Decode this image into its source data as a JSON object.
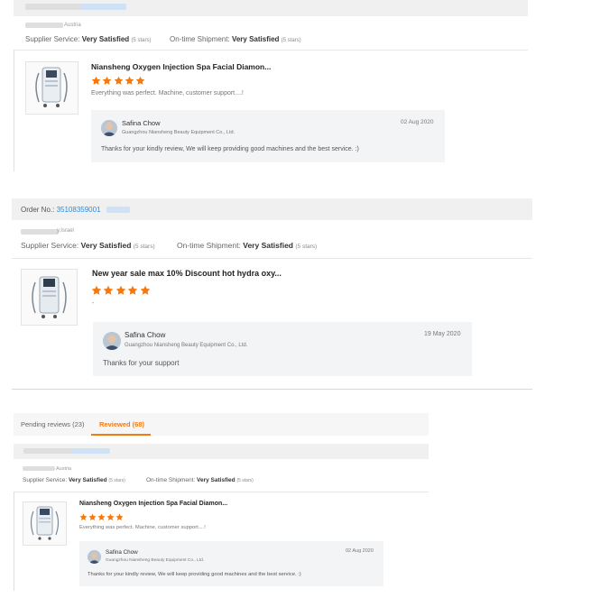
{
  "card1": {
    "country": "Austria",
    "supplier_service_label": "Supplier Service:",
    "supplier_service_value": "Very Satisfied",
    "supplier_service_stars": "(5 stars)",
    "ontime_label": "On-time Shipment:",
    "ontime_value": "Very Satisfied",
    "ontime_stars": "(5 stars)",
    "product_title": "Niansheng Oxygen Injection Spa Facial Diamon...",
    "rating": 5,
    "review": "Everything was perfect. Machine, customer support....!",
    "reply_name": "Safina Chow",
    "reply_company": "Guangzhou Niansheng Beauty Equipment Co., Ltd.",
    "reply_date": "02 Aug 2020",
    "reply_text": "Thanks for your kindly review, We will keep providing good machines and the best service. :)"
  },
  "card2": {
    "order_label": "Order No.:",
    "order_no": "35108359001",
    "country": "y,Israel",
    "supplier_service_label": "Supplier Service:",
    "supplier_service_value": "Very Satisfied",
    "supplier_service_stars": "(5 stars)",
    "ontime_label": "On-time Shipment:",
    "ontime_value": "Very Satisfied",
    "ontime_stars": "(5 stars)",
    "product_title": "New year sale max 10% Discount hot hydra oxy...",
    "rating": 5,
    "review": "-",
    "reply_name": "Safina Chow",
    "reply_company": "Guangzhou Niansheng Beauty Equipment Co., Ltd.",
    "reply_date": "19 May 2020",
    "reply_text": "Thanks for your support"
  },
  "tabs": {
    "pending": "Pending reviews (23)",
    "reviewed": "Reviewed (68)"
  },
  "card3": {
    "country": "Austria",
    "supplier_service_label": "Supplier Service:",
    "supplier_service_value": "Very Satisfied",
    "supplier_service_stars": "(5 stars)",
    "ontime_label": "On-time Shipment:",
    "ontime_value": "Very Satisfied",
    "ontime_stars": "(5 stars)",
    "product_title": "Niansheng Oxygen Injection Spa Facial Diamon...",
    "rating": 5,
    "review": "Everything was perfect. Machine, customer support....!",
    "reply_name": "Safina Chow",
    "reply_company": "Guangzhou Niansheng Beauty Equipment Co., Ltd.",
    "reply_date": "02 Aug 2020",
    "reply_text": "Thanks for your kindly review, We will keep providing good machines and the best service. :)"
  },
  "colors": {
    "star": "#f5790f",
    "link": "#2a8ce0",
    "tab_active": "#f5790f",
    "header_bar": "#f0f0f0"
  },
  "icons": {
    "star": "star-icon",
    "avatar": "avatar-photo",
    "product": "beauty-machine-image"
  }
}
